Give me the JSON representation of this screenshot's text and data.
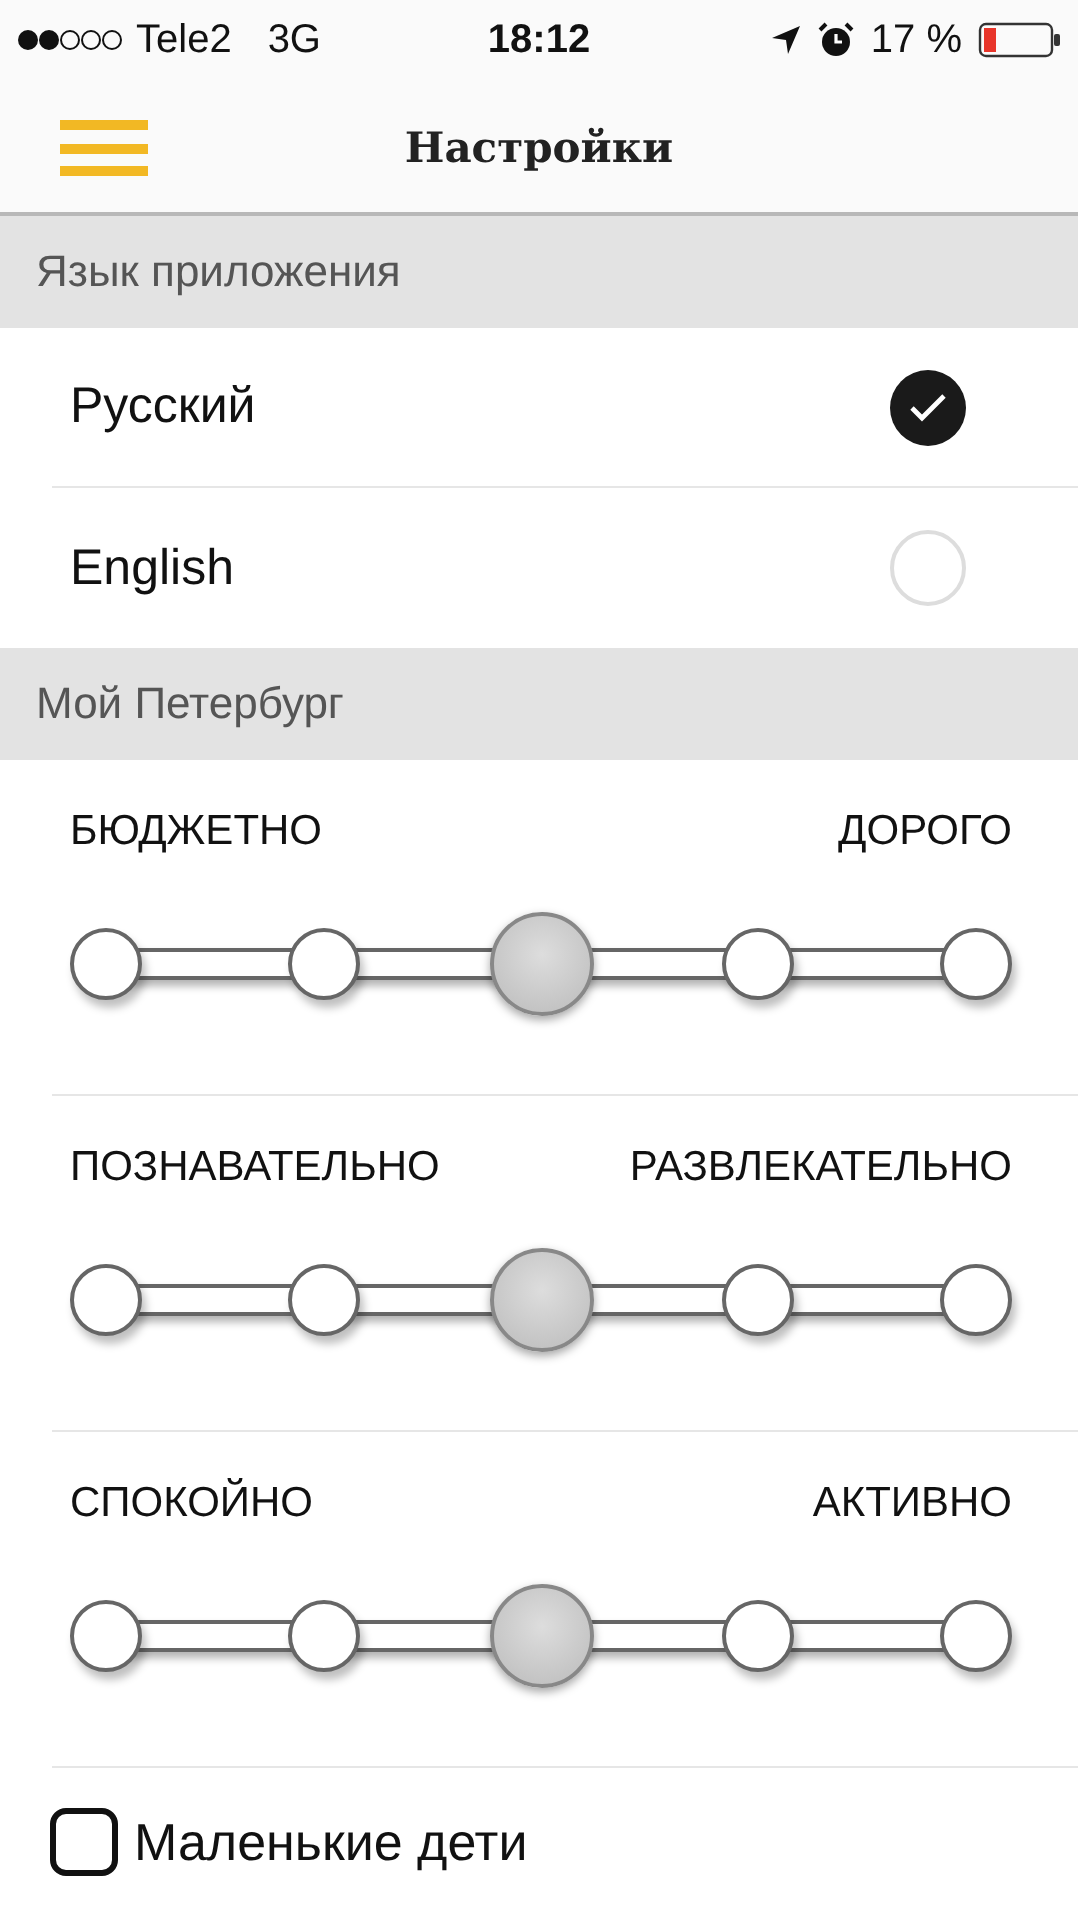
{
  "status_bar": {
    "carrier": "Tele2",
    "network": "3G",
    "time": "18:12",
    "battery": "17 %"
  },
  "nav": {
    "title": "Настройки"
  },
  "language": {
    "header": "Язык приложения",
    "options": [
      {
        "label": "Русский",
        "selected": true
      },
      {
        "label": "English",
        "selected": false
      }
    ]
  },
  "preferences": {
    "header": "Мой Петербург",
    "sliders": [
      {
        "left": "БЮДЖЕТНО",
        "right": "ДОРОГО",
        "level": 0.5
      },
      {
        "left": "ПОЗНАВАТЕЛЬНО",
        "right": "РАЗВЛЕКАТЕЛЬНО",
        "level": 0.5
      },
      {
        "left": "СПОКОЙНО",
        "right": "АКТИВНО",
        "level": 0.5
      }
    ],
    "checkbox": {
      "label": "Маленькие дети",
      "checked": false
    }
  }
}
